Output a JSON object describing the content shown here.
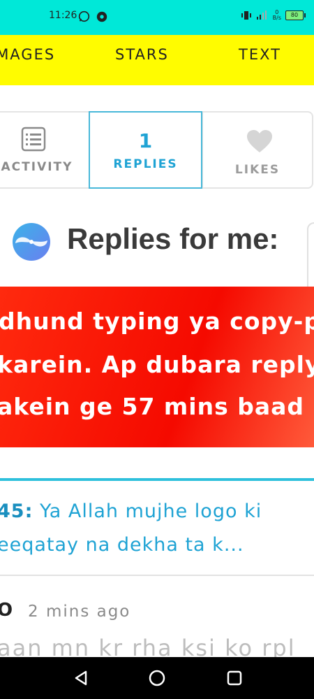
{
  "status_bar": {
    "time": "11:26",
    "battery": "80",
    "net_speed_top": "0",
    "net_speed_bottom": "B/s",
    "network": "4G"
  },
  "top_tabs": [
    "IMAGES",
    "STARS",
    "TEXT"
  ],
  "segments": {
    "activity_label": "ACTIVITY",
    "replies_count": "1",
    "replies_label": "REPLIES",
    "likes_label": "LIKES"
  },
  "heading": "Replies for me:",
  "warning": {
    "line1": "dhund typing ya copy-pa",
    "line2": "karein. Ap dubara reply",
    "line3": "akein ge 57 mins baad"
  },
  "reply": {
    "user": "45:",
    "text": "Ya Allah mujhe logo ki",
    "text2": "eeqatay na dekha ta k..."
  },
  "next_reply": {
    "user": "O",
    "time": "2 mins ago",
    "text": "aan mn kr rha ksi ko rpl"
  },
  "colors": {
    "status_bar": "#00e8d8",
    "tabs_bar": "#fffc00",
    "accent": "#1fa3d4",
    "warning": "#f50a00"
  }
}
